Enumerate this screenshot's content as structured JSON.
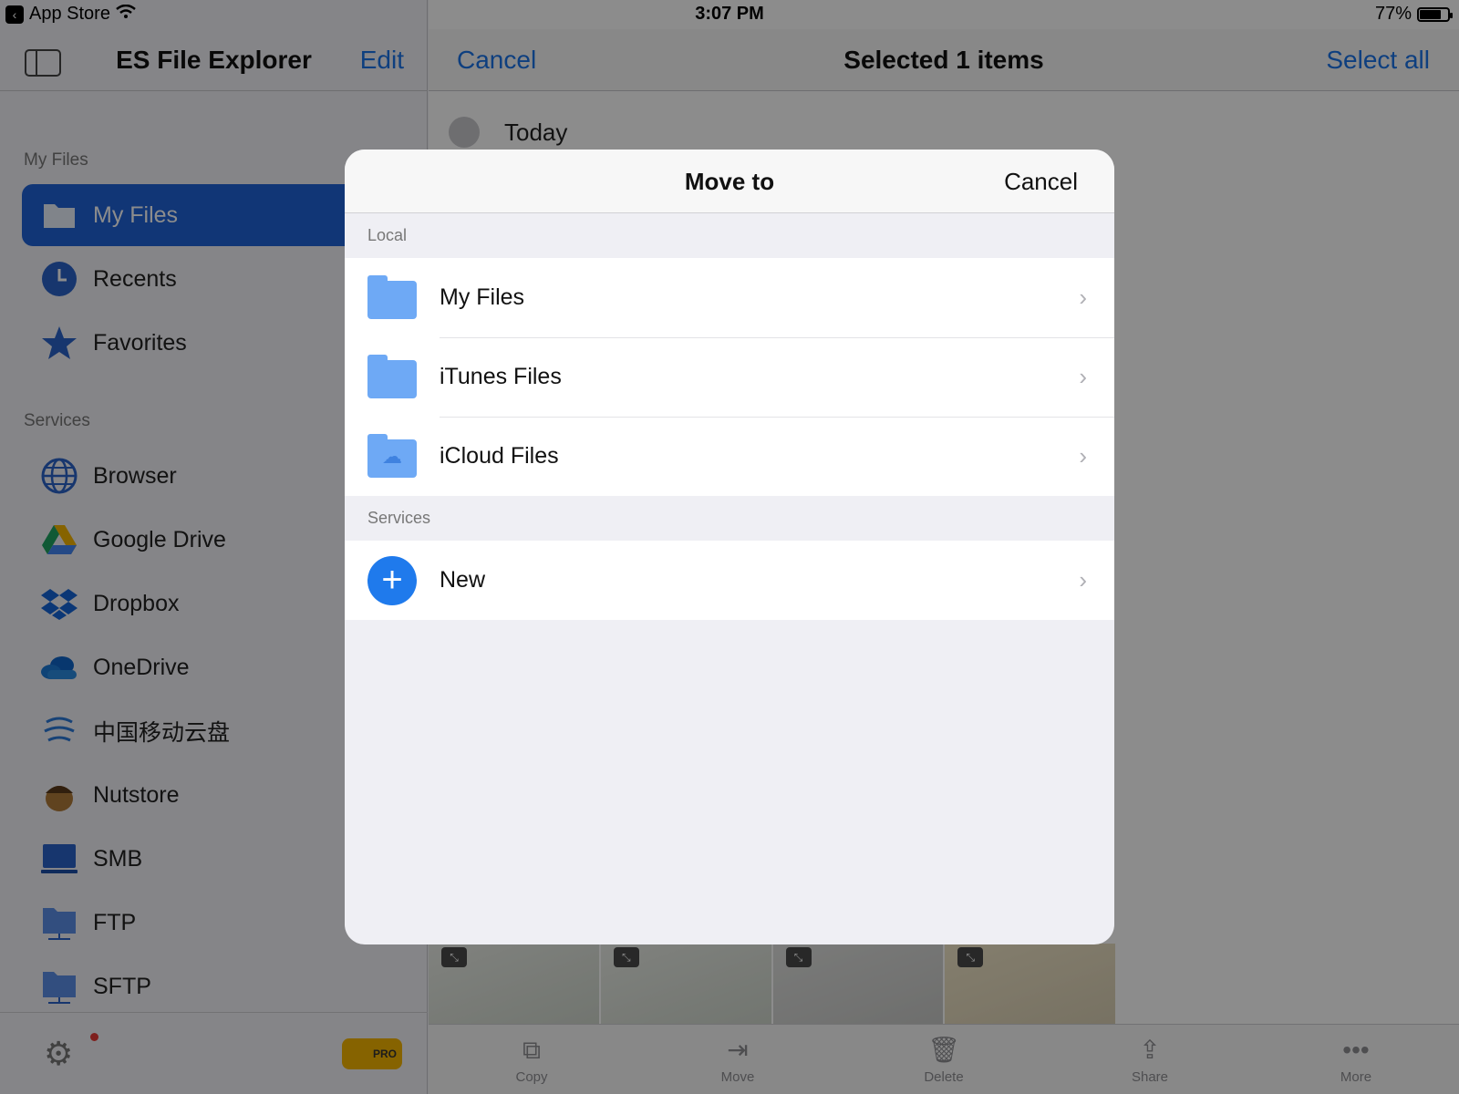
{
  "status_bar": {
    "back_app": "App Store",
    "time": "3:07 PM",
    "battery": "77%",
    "battery_level": 0.77
  },
  "sidebar": {
    "title": "ES File Explorer",
    "edit_label": "Edit",
    "section_my_files": "My Files",
    "section_services": "Services",
    "my_files_items": [
      {
        "label": "My Files",
        "icon": "folder-icon",
        "active": true
      },
      {
        "label": "Recents",
        "icon": "clock-icon"
      },
      {
        "label": "Favorites",
        "icon": "star-icon"
      }
    ],
    "service_items": [
      {
        "label": "Browser",
        "icon": "globe-icon"
      },
      {
        "label": "Google Drive",
        "icon": "google-drive-icon"
      },
      {
        "label": "Dropbox",
        "icon": "dropbox-icon"
      },
      {
        "label": "OneDrive",
        "icon": "onedrive-icon"
      },
      {
        "label": "中国移动云盘",
        "icon": "china-mobile-cloud-icon"
      },
      {
        "label": "Nutstore",
        "icon": "nutstore-icon"
      },
      {
        "label": "SMB",
        "icon": "smb-icon"
      },
      {
        "label": "FTP",
        "icon": "ftp-icon"
      },
      {
        "label": "SFTP",
        "icon": "sftp-icon"
      }
    ],
    "pro_badge": "PRO"
  },
  "main": {
    "cancel_label": "Cancel",
    "title": "Selected 1 items",
    "select_all_label": "Select all",
    "today_label": "Today",
    "toolbar": [
      {
        "label": "Copy",
        "icon": "copy-icon"
      },
      {
        "label": "Move",
        "icon": "move-icon"
      },
      {
        "label": "Delete",
        "icon": "trash-icon"
      },
      {
        "label": "Share",
        "icon": "share-icon"
      },
      {
        "label": "More",
        "icon": "more-icon"
      }
    ]
  },
  "modal": {
    "title": "Move to",
    "cancel_label": "Cancel",
    "local_label": "Local",
    "local_items": [
      {
        "label": "My Files",
        "icon": "folder-icon"
      },
      {
        "label": "iTunes Files",
        "icon": "itunes-folder-icon"
      },
      {
        "label": "iCloud Files",
        "icon": "icloud-folder-icon"
      }
    ],
    "services_label": "Services",
    "service_items": [
      {
        "label": "New",
        "icon": "plus-icon"
      }
    ]
  },
  "colors": {
    "accent": "#1a73e8",
    "active_nav": "#1f63d8",
    "folder": "#6ea9f5"
  }
}
